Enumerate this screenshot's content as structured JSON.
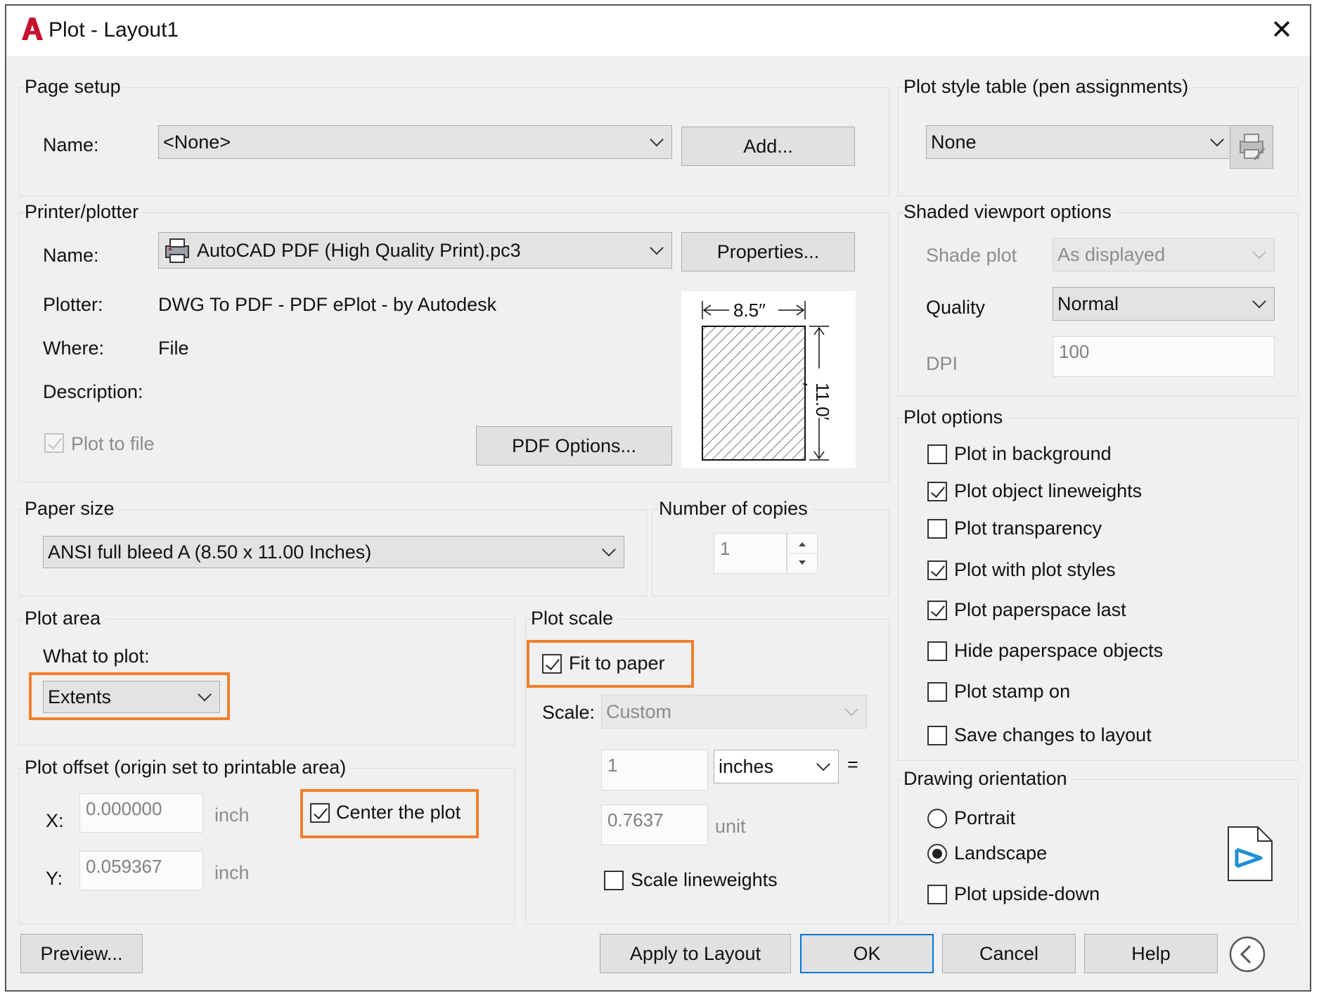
{
  "window": {
    "title": "Plot - Layout1",
    "logo_letter": "A"
  },
  "page_setup": {
    "group": "Page setup",
    "name_label": "Name:",
    "name_value": "<None>",
    "add_button": "Add..."
  },
  "printer": {
    "group": "Printer/plotter",
    "name_label": "Name:",
    "name_value": "AutoCAD PDF (High Quality Print).pc3",
    "properties_button": "Properties...",
    "plotter_label": "Plotter:",
    "plotter_value": "DWG To PDF - PDF ePlot - by Autodesk",
    "where_label": "Where:",
    "where_value": "File",
    "description_label": "Description:",
    "plot_to_file": "Plot to file",
    "plot_to_file_checked": true,
    "pdf_options_button": "PDF Options...",
    "preview_width": "8.5′′",
    "preview_height": "11.0′′"
  },
  "paper_size": {
    "group": "Paper size",
    "value": "ANSI full bleed A (8.50 x 11.00 Inches)"
  },
  "copies": {
    "group": "Number of copies",
    "value": "1"
  },
  "plot_area": {
    "group": "Plot area",
    "what_label": "What to plot:",
    "what_value": "Extents"
  },
  "plot_offset": {
    "group": "Plot offset (origin set to printable area)",
    "x_label": "X:",
    "x_value": "0.000000",
    "x_unit": "inch",
    "y_label": "Y:",
    "y_value": "0.059367",
    "y_unit": "inch",
    "center": "Center the plot",
    "center_checked": true
  },
  "plot_scale": {
    "group": "Plot scale",
    "fit": "Fit to paper",
    "fit_checked": true,
    "scale_label": "Scale:",
    "scale_value": "Custom",
    "value1": "1",
    "unit1": "inches",
    "equals": "=",
    "value2": "0.7637",
    "unit2": "unit",
    "lineweights": "Scale lineweights",
    "lineweights_checked": false
  },
  "style_table": {
    "group": "Plot style table (pen assignments)",
    "value": "None"
  },
  "shaded": {
    "group": "Shaded viewport options",
    "shade_label": "Shade plot",
    "shade_value": "As displayed",
    "quality_label": "Quality",
    "quality_value": "Normal",
    "dpi_label": "DPI",
    "dpi_value": "100"
  },
  "plot_options": {
    "group": "Plot options",
    "items": [
      {
        "label": "Plot in background",
        "checked": false
      },
      {
        "label": "Plot object lineweights",
        "checked": true
      },
      {
        "label": "Plot transparency",
        "checked": false
      },
      {
        "label": "Plot with plot styles",
        "checked": true
      },
      {
        "label": "Plot paperspace last",
        "checked": true
      },
      {
        "label": "Hide paperspace objects",
        "checked": false
      },
      {
        "label": "Plot stamp on",
        "checked": false
      },
      {
        "label": "Save changes to layout",
        "checked": false
      }
    ]
  },
  "orientation": {
    "group": "Drawing orientation",
    "portrait": "Portrait",
    "landscape": "Landscape",
    "selected": "landscape",
    "upside_down": "Plot upside-down",
    "upside_down_checked": false
  },
  "footer": {
    "preview": "Preview...",
    "apply": "Apply to Layout",
    "ok": "OK",
    "cancel": "Cancel",
    "help": "Help"
  },
  "colors": {
    "accent": "#0078d7",
    "highlight": "#f0802c",
    "logo_red": "#c8102e"
  }
}
